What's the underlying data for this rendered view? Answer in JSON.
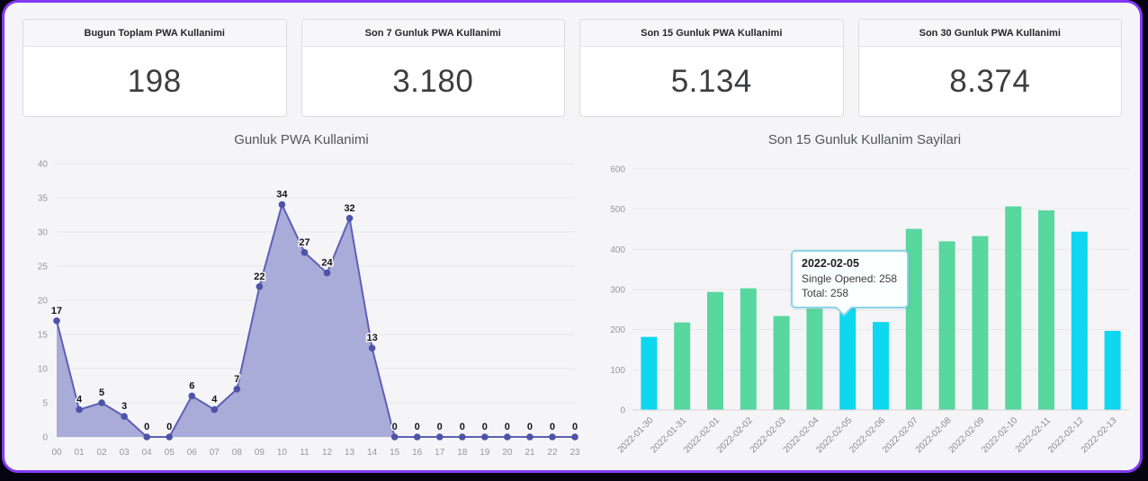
{
  "frame": {
    "outside_color": "#060410",
    "border_color": "#8438f4",
    "background": "#f5f5f7"
  },
  "stat_cards": [
    {
      "label": "Bugun Toplam PWA Kullanimi",
      "value": "198"
    },
    {
      "label": "Son 7 Gunluk PWA Kullanimi",
      "value": "3.180"
    },
    {
      "label": "Son 15 Gunluk PWA Kullanimi",
      "value": "5.134"
    },
    {
      "label": "Son 30 Gunluk PWA Kullanimi",
      "value": "8.374"
    }
  ],
  "chart_data": [
    {
      "type": "area",
      "title": "Gunluk PWA Kullanimi",
      "x_labels": [
        "00",
        "01",
        "02",
        "03",
        "04",
        "05",
        "06",
        "07",
        "08",
        "09",
        "10",
        "11",
        "12",
        "13",
        "14",
        "15",
        "16",
        "17",
        "18",
        "19",
        "20",
        "21",
        "22",
        "23"
      ],
      "values": [
        17,
        4,
        5,
        3,
        0,
        0,
        6,
        4,
        7,
        22,
        34,
        27,
        24,
        32,
        13,
        0,
        0,
        0,
        0,
        0,
        0,
        0,
        0,
        0
      ],
      "ylim": [
        0,
        40
      ],
      "ytick_step": 5,
      "grid": true,
      "point_labels": true,
      "colors": {
        "line": "#5d60b6",
        "fill": "#a9abd8",
        "point": "#4e53a8",
        "grid": "#e8e8eb",
        "tick_text": "#97979c",
        "label_text": "#141414"
      }
    },
    {
      "type": "bar",
      "title": "Son 15 Gunluk Kullanim Sayilari",
      "categories": [
        "2022-01-30",
        "2022-01-31",
        "2022-02-01",
        "2022-02-02",
        "2022-02-03",
        "2022-02-04",
        "2022-02-05",
        "2022-02-06",
        "2022-02-07",
        "2022-02-08",
        "2022-02-09",
        "2022-02-10",
        "2022-02-11",
        "2022-02-12",
        "2022-02-13"
      ],
      "values": [
        182,
        218,
        294,
        303,
        234,
        252,
        258,
        219,
        451,
        420,
        433,
        507,
        497,
        444,
        197
      ],
      "highlight_indices": [
        0,
        6,
        7,
        13,
        14
      ],
      "ylim": [
        0,
        600
      ],
      "ytick_step": 100,
      "grid": true,
      "legend": "none",
      "colors": {
        "bar": "#58d79e",
        "highlight": "#0ed7f0",
        "grid": "#e8e8eb",
        "axis": "#d4d4dc",
        "tick_text": "#97979c",
        "cat_text": "#8a8a8f"
      },
      "tooltip": {
        "title": "2022-02-05",
        "lines": [
          "Single Opened: 258",
          "Total: 258"
        ],
        "anchor_index": 6
      }
    }
  ]
}
